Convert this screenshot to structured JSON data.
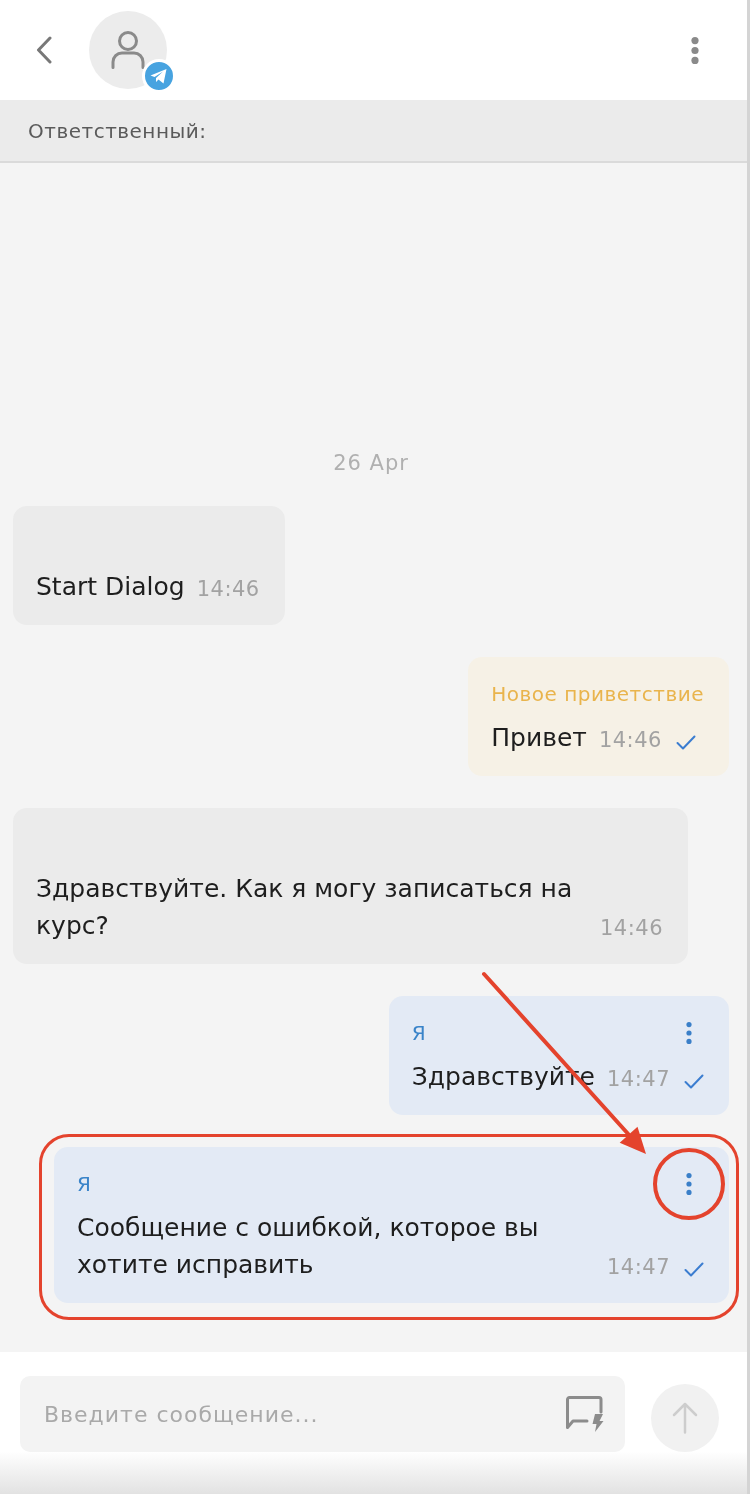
{
  "responsible": {
    "label": "Ответственный:"
  },
  "date_divider": {
    "label": "26 Apr"
  },
  "messages": [
    {
      "kind": "incoming",
      "text": "Start Dialog",
      "time": "14:46",
      "highlighted": false
    },
    {
      "kind": "template",
      "title": "Новое приветствие",
      "text": "Привет",
      "time": "14:46",
      "delivered": true,
      "highlighted": false
    },
    {
      "kind": "incoming",
      "text": "Здравствуйте. Как я могу записаться на курс?",
      "time": "14:46",
      "highlighted": false
    },
    {
      "kind": "own",
      "author": "Я",
      "text": "Здравствуйте",
      "time": "14:47",
      "delivered": true,
      "highlighted": false
    },
    {
      "kind": "own",
      "author": "Я",
      "text": "Сообщение с ошибкой, которое вы хотите исправить",
      "time": "14:47",
      "delivered": true,
      "highlighted": true
    }
  ],
  "composer": {
    "placeholder": "Введите сообщение..."
  }
}
